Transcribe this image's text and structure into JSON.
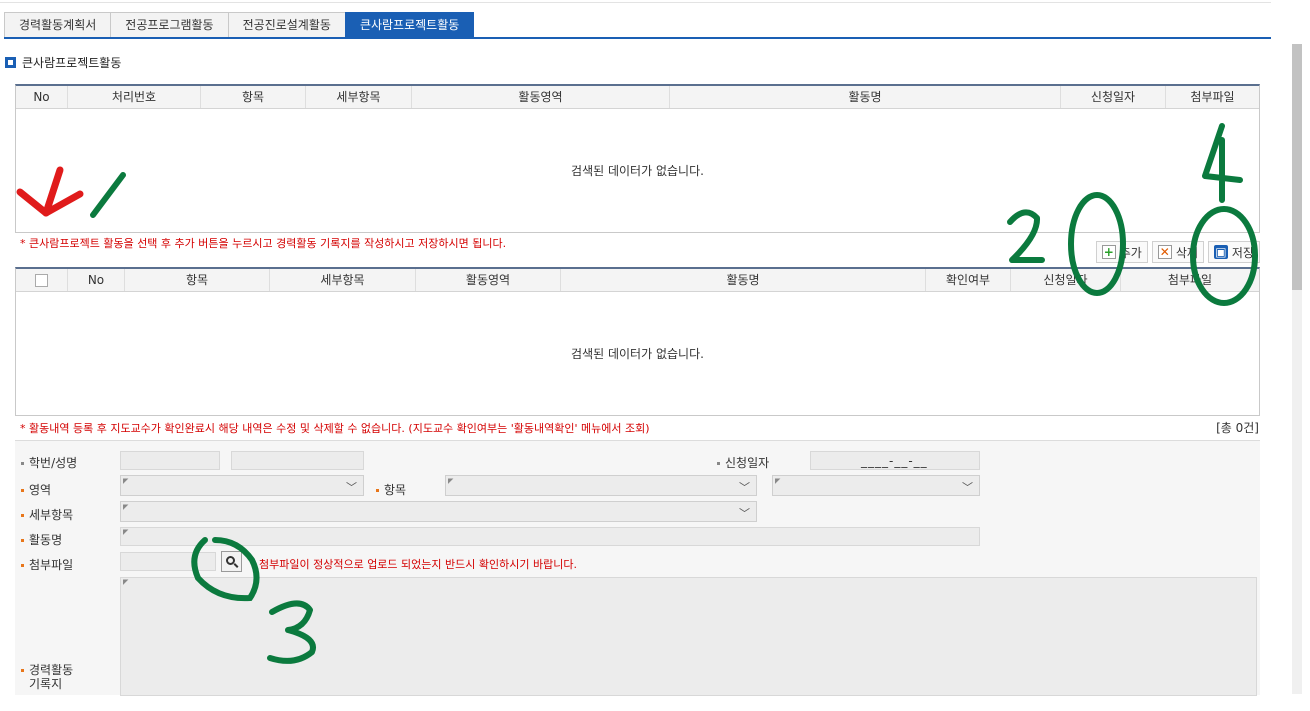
{
  "tabs": [
    {
      "label": "경력활동계획서",
      "active": false
    },
    {
      "label": "전공프로그램활동",
      "active": false
    },
    {
      "label": "전공진로설계활동",
      "active": false
    },
    {
      "label": "큰사람프로젝트활동",
      "active": true
    }
  ],
  "section_title": "큰사람프로젝트활동",
  "grid1": {
    "columns": [
      "No",
      "처리번호",
      "항목",
      "세부항목",
      "활동영역",
      "활동명",
      "신청일자",
      "첨부파일"
    ],
    "empty_message": "검색된 데이터가 없습니다."
  },
  "note1": "* 큰사람프로젝트 활동을 선택 후 추가 버튼을 누르시고 경력활동 기록지를 작성하시고 저장하시면 됩니다.",
  "toolbar": {
    "add_label": "추가",
    "delete_label": "삭제",
    "save_label": "저장"
  },
  "grid2": {
    "columns": [
      "",
      "No",
      "항목",
      "세부항목",
      "활동영역",
      "활동명",
      "확인여부",
      "신청일자",
      "첨부파일"
    ],
    "empty_message": "검색된 데이터가 없습니다."
  },
  "note2": "* 활동내역 등록 후 지도교수가 확인완료시 해당 내역은 수정 및 삭제할 수 없습니다. (지도교수 확인여부는 '활동내역확인' 메뉴에서 조회)",
  "total_count": "[총 0건]",
  "form": {
    "student_label": "학번/성명",
    "apply_date_label": "신청일자",
    "apply_date_value": "____-__-__",
    "area_label": "영역",
    "item_label": "항목",
    "detail_label": "세부항목",
    "activity_name_label": "활동명",
    "attachment_label": "첨부파일",
    "attachment_note": "* 첨부파일이 정상적으로 업로드 되었는지 반드시 확인하시기 바랍니다.",
    "record_label_1": "경력활동",
    "record_label_2": "기록지"
  },
  "annotations": {
    "numbers": [
      "1",
      "2",
      "3",
      "4"
    ],
    "ink_colors": {
      "red": "#e01b1b",
      "green": "#0b7a3e"
    }
  },
  "colors": {
    "accent": "#1a5fb4",
    "note_red": "#d40000",
    "required_dot": "#e8761a"
  }
}
